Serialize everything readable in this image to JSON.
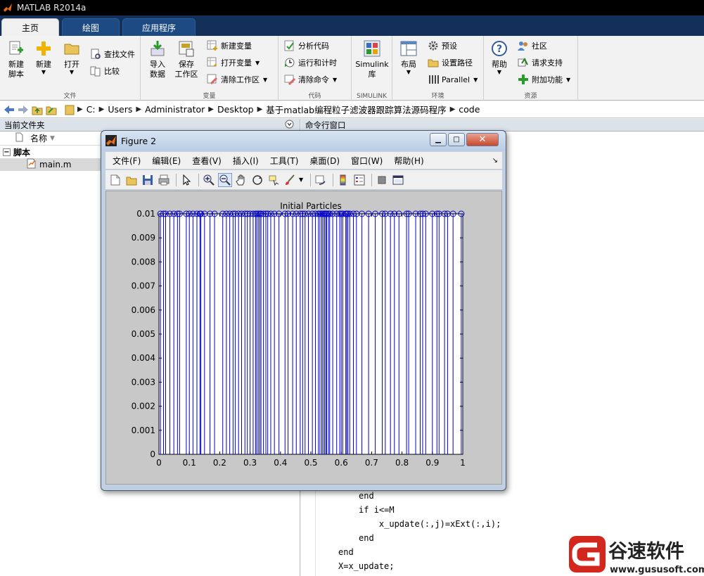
{
  "app": {
    "title": "MATLAB R2014a"
  },
  "tabs": [
    {
      "label": "主页"
    },
    {
      "label": "绘图"
    },
    {
      "label": "应用程序"
    }
  ],
  "ribbon": {
    "file": {
      "label": "文件",
      "new_script": {
        "line1": "新建",
        "line2": "脚本"
      },
      "new": "新建",
      "open": "打开",
      "find_files": "查找文件",
      "compare": "比较"
    },
    "variable": {
      "label": "变量",
      "import": {
        "line1": "导入",
        "line2": "数据"
      },
      "save": {
        "line1": "保存",
        "line2": "工作区"
      },
      "new_variable": "新建变量",
      "open_variable": "打开变量",
      "clear_workspace": "清除工作区"
    },
    "code": {
      "label": "代码",
      "analyze": "分析代码",
      "run_time": "运行和计时",
      "clear_commands": "清除命令"
    },
    "simulink": {
      "label": "SIMULINK",
      "btn": {
        "line1": "Simulink",
        "line2": "库"
      }
    },
    "environment": {
      "label": "环境",
      "layout": "布局",
      "preferences": "预设",
      "set_path": "设置路径",
      "parallel": "Parallel"
    },
    "resources": {
      "label": "资源",
      "help": "帮助",
      "community": "社区",
      "request_support": "请求支持",
      "addons": "附加功能"
    }
  },
  "address": {
    "crumbs": [
      "C:",
      "Users",
      "Administrator",
      "Desktop",
      "基于matlab编程粒子滤波器跟踪算法源码程序",
      "code"
    ]
  },
  "left_panel": {
    "title": "当前文件夹",
    "column_name": "名称",
    "folder": "脚本",
    "file": "main.m"
  },
  "right_panel": {
    "title": "命令行窗口",
    "code_lines": [
      "end",
      "if i<=M",
      "    x_update(:,j)=xExt(:,i);",
      "end",
      "end",
      "X=x_update;"
    ]
  },
  "figure": {
    "window_title": "Figure 2",
    "menus": [
      "文件(F)",
      "编辑(E)",
      "查看(V)",
      "插入(I)",
      "工具(T)",
      "桌面(D)",
      "窗口(W)",
      "帮助(H)"
    ]
  },
  "chart_data": {
    "type": "stem",
    "title": "Initial Particles",
    "xlabel": "",
    "ylabel": "",
    "xlim": [
      0,
      1
    ],
    "ylim": [
      0,
      0.01
    ],
    "xticks": [
      0,
      0.1,
      0.2,
      0.3,
      0.4,
      0.5,
      0.6,
      0.7,
      0.8,
      0.9,
      1
    ],
    "xtick_labels": [
      "0",
      "0.1",
      "0.2",
      "0.3",
      "0.4",
      "0.5",
      "0.6",
      "0.7",
      "0.8",
      "0.9",
      "1"
    ],
    "yticks": [
      0,
      0.001,
      0.002,
      0.003,
      0.004,
      0.005,
      0.006,
      0.007,
      0.008,
      0.009,
      0.01
    ],
    "ytick_labels": [
      "0",
      "0.001",
      "0.002",
      "0.003",
      "0.004",
      "0.005",
      "0.006",
      "0.007",
      "0.008",
      "0.009",
      "0.01"
    ],
    "series": [
      {
        "color": "#0000cc",
        "marker": "circle",
        "x": [
          0.005,
          0.015,
          0.022,
          0.036,
          0.049,
          0.061,
          0.068,
          0.09,
          0.1,
          0.112,
          0.125,
          0.135,
          0.138,
          0.15,
          0.168,
          0.183,
          0.21,
          0.222,
          0.233,
          0.244,
          0.251,
          0.262,
          0.272,
          0.283,
          0.291,
          0.3,
          0.31,
          0.318,
          0.322,
          0.327,
          0.332,
          0.336,
          0.344,
          0.352,
          0.358,
          0.368,
          0.38,
          0.395,
          0.415,
          0.425,
          0.44,
          0.452,
          0.465,
          0.473,
          0.481,
          0.492,
          0.505,
          0.515,
          0.525,
          0.53,
          0.536,
          0.54,
          0.545,
          0.549,
          0.552,
          0.558,
          0.562,
          0.572,
          0.585,
          0.595,
          0.6,
          0.605,
          0.615,
          0.618,
          0.622,
          0.628,
          0.64,
          0.65,
          0.668,
          0.69,
          0.712,
          0.735,
          0.745,
          0.762,
          0.775,
          0.79,
          0.815,
          0.822,
          0.845,
          0.86,
          0.868,
          0.878,
          0.9,
          0.915,
          0.922,
          0.94,
          0.95,
          0.968,
          0.995
        ],
        "values": [
          0.01,
          0.01,
          0.01,
          0.01,
          0.01,
          0.01,
          0.01,
          0.01,
          0.01,
          0.01,
          0.01,
          0.01,
          0.01,
          0.01,
          0.01,
          0.01,
          0.01,
          0.01,
          0.01,
          0.01,
          0.01,
          0.01,
          0.01,
          0.01,
          0.01,
          0.01,
          0.01,
          0.01,
          0.01,
          0.01,
          0.01,
          0.01,
          0.01,
          0.01,
          0.01,
          0.01,
          0.01,
          0.01,
          0.01,
          0.01,
          0.01,
          0.01,
          0.01,
          0.01,
          0.01,
          0.01,
          0.01,
          0.01,
          0.01,
          0.01,
          0.01,
          0.01,
          0.01,
          0.01,
          0.01,
          0.01,
          0.01,
          0.01,
          0.01,
          0.01,
          0.01,
          0.01,
          0.01,
          0.01,
          0.01,
          0.01,
          0.01,
          0.01,
          0.01,
          0.01,
          0.01,
          0.01,
          0.01,
          0.01,
          0.01,
          0.01,
          0.01,
          0.01,
          0.01,
          0.01,
          0.01,
          0.01,
          0.01,
          0.01,
          0.01,
          0.01,
          0.01,
          0.01,
          0.01
        ]
      }
    ],
    "grid": false
  },
  "watermark": {
    "name": "谷速软件",
    "url": "www.gususoft.com"
  }
}
